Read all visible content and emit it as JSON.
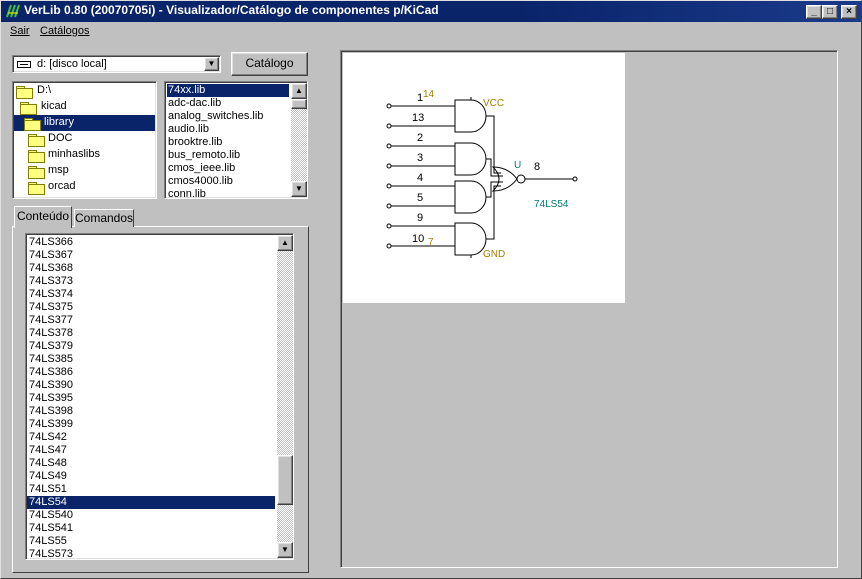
{
  "window": {
    "title": "VerLib 0.80 (20070705i) - Visualizador/Catálogo de componentes p/KiCad",
    "minimize": "_",
    "maximize": "□",
    "close": "×"
  },
  "menu": {
    "items": [
      {
        "label": "Sair"
      },
      {
        "label": "Catálogos"
      }
    ]
  },
  "drive": {
    "selected": "d: [disco local]",
    "arrow": "▼"
  },
  "catalog_button": "Catálogo",
  "folder_tree": {
    "items": [
      {
        "label": "D:\\"
      },
      {
        "label": "kicad"
      },
      {
        "label": "library"
      },
      {
        "label": "DOC"
      },
      {
        "label": "minhaslibs"
      },
      {
        "label": "msp"
      },
      {
        "label": "orcad"
      }
    ],
    "selected": "library"
  },
  "lib_list": {
    "items": [
      "74xx.lib",
      "adc-dac.lib",
      "analog_switches.lib",
      "audio.lib",
      "brooktre.lib",
      "bus_remoto.lib",
      "cmos_ieee.lib",
      "cmos4000.lib",
      "conn.lib"
    ],
    "selected": "74xx.lib",
    "up": "▲",
    "down": "▼"
  },
  "tabs": [
    {
      "label": "Conteúdo",
      "active": true
    },
    {
      "label": "Comandos",
      "active": false
    }
  ],
  "components": {
    "items": [
      "74LS366",
      "74LS367",
      "74LS368",
      "74LS373",
      "74LS374",
      "74LS375",
      "74LS377",
      "74LS378",
      "74LS379",
      "74LS385",
      "74LS386",
      "74LS390",
      "74LS395",
      "74LS398",
      "74LS399",
      "74LS42",
      "74LS47",
      "74LS48",
      "74LS49",
      "74LS51",
      "74LS54",
      "74LS540",
      "74LS541",
      "74LS55",
      "74LS573"
    ],
    "selected": "74LS54",
    "up": "▲",
    "down": "▼"
  },
  "schematic": {
    "input_pins": [
      "1",
      "13",
      "2",
      "3",
      "4",
      "5",
      "9",
      "10"
    ],
    "vcc_pin": "14",
    "gnd_pin": "7",
    "vcc_label": "VCC",
    "gnd_label": "GND",
    "unit_ref": "U",
    "output_pin": "8",
    "part_name": "74LS54",
    "colors": {
      "pin_number": "#000000",
      "power": "#a08000",
      "name": "#007878"
    }
  }
}
